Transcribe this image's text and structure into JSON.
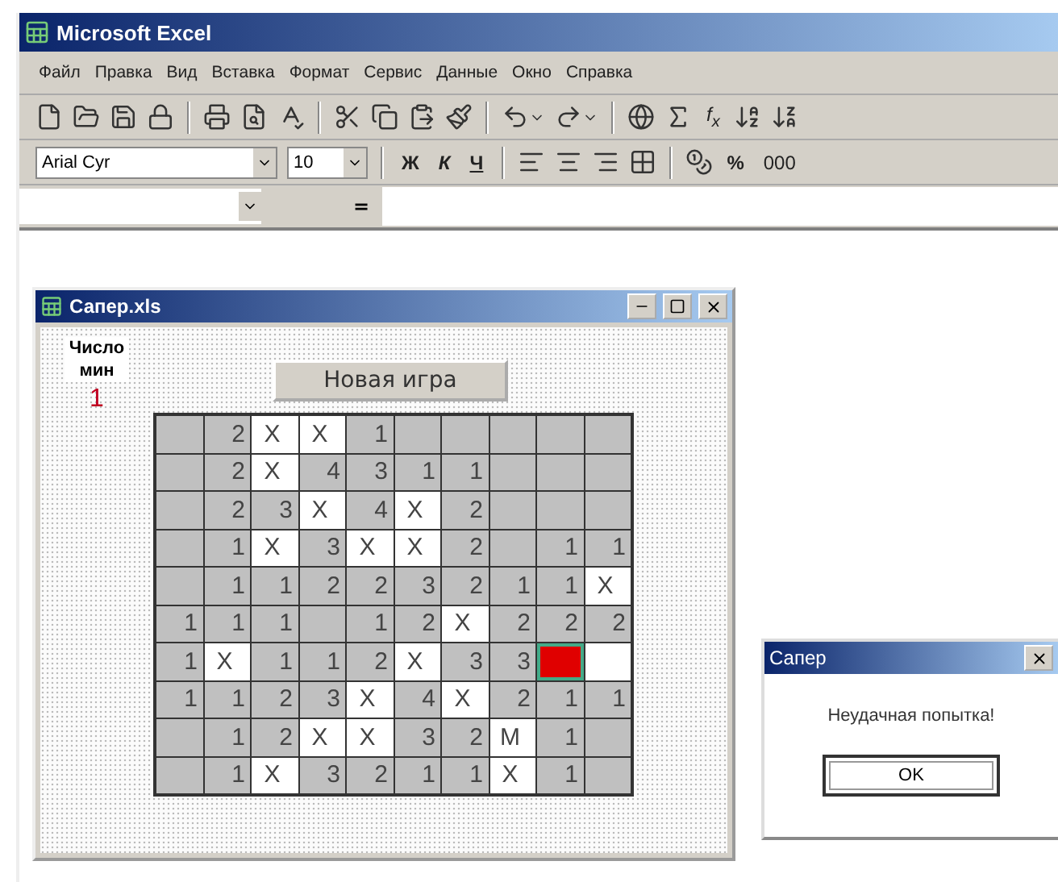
{
  "app": {
    "title": "Microsoft Excel"
  },
  "menu": [
    "Файл",
    "Правка",
    "Вид",
    "Вставка",
    "Формат",
    "Сервис",
    "Данные",
    "Окно",
    "Справка"
  ],
  "toolbar_standard": {
    "function_label": "f$_{x}$"
  },
  "toolbar_format": {
    "font": "Arial Cyr",
    "size": "10",
    "bold": "Ж",
    "italic": "К",
    "underline": "Ч",
    "percent": "%",
    "thousands": "000"
  },
  "formula_bar": {
    "equals": "="
  },
  "workbook": {
    "title": "Сапер.xls",
    "mines_label": "Число мин",
    "mines_count": "1",
    "new_game_button": "Новая игра",
    "grid": [
      [
        {
          "kind": "plain"
        },
        {
          "t": "2",
          "kind": "plain"
        },
        {
          "t": "X",
          "kind": "marked"
        },
        {
          "t": "X",
          "kind": "marked"
        },
        {
          "t": "1",
          "kind": "plain"
        },
        {
          "kind": "plain"
        },
        {
          "kind": "plain"
        },
        {
          "kind": "plain"
        },
        {
          "kind": "plain"
        },
        {
          "kind": "plain"
        }
      ],
      [
        {
          "kind": "plain"
        },
        {
          "t": "2",
          "kind": "plain"
        },
        {
          "t": "X",
          "kind": "marked"
        },
        {
          "t": "4",
          "kind": "plain"
        },
        {
          "t": "3",
          "kind": "plain"
        },
        {
          "t": "1",
          "kind": "plain"
        },
        {
          "t": "1",
          "kind": "plain"
        },
        {
          "kind": "plain"
        },
        {
          "kind": "plain"
        },
        {
          "kind": "plain"
        }
      ],
      [
        {
          "kind": "plain"
        },
        {
          "t": "2",
          "kind": "plain"
        },
        {
          "t": "3",
          "kind": "plain"
        },
        {
          "t": "X",
          "kind": "marked"
        },
        {
          "t": "4",
          "kind": "plain"
        },
        {
          "t": "X",
          "kind": "marked"
        },
        {
          "t": "2",
          "kind": "plain"
        },
        {
          "kind": "plain"
        },
        {
          "kind": "plain"
        },
        {
          "kind": "plain"
        }
      ],
      [
        {
          "kind": "plain"
        },
        {
          "t": "1",
          "kind": "plain"
        },
        {
          "t": "X",
          "kind": "marked"
        },
        {
          "t": "3",
          "kind": "plain"
        },
        {
          "t": "X",
          "kind": "marked"
        },
        {
          "t": "X",
          "kind": "marked"
        },
        {
          "t": "2",
          "kind": "plain"
        },
        {
          "kind": "plain"
        },
        {
          "t": "1",
          "kind": "plain"
        },
        {
          "t": "1",
          "kind": "plain"
        }
      ],
      [
        {
          "kind": "plain"
        },
        {
          "t": "1",
          "kind": "plain"
        },
        {
          "t": "1",
          "kind": "plain"
        },
        {
          "t": "2",
          "kind": "plain"
        },
        {
          "t": "2",
          "kind": "plain"
        },
        {
          "t": "3",
          "kind": "plain"
        },
        {
          "t": "2",
          "kind": "plain"
        },
        {
          "t": "1",
          "kind": "plain"
        },
        {
          "t": "1",
          "kind": "plain"
        },
        {
          "t": "X",
          "kind": "marked"
        }
      ],
      [
        {
          "t": "1",
          "kind": "plain"
        },
        {
          "t": "1",
          "kind": "plain"
        },
        {
          "t": "1",
          "kind": "plain"
        },
        {
          "kind": "plain"
        },
        {
          "t": "1",
          "kind": "plain"
        },
        {
          "t": "2",
          "kind": "plain"
        },
        {
          "t": "X",
          "kind": "marked"
        },
        {
          "t": "2",
          "kind": "plain"
        },
        {
          "t": "2",
          "kind": "plain"
        },
        {
          "t": "2",
          "kind": "plain"
        }
      ],
      [
        {
          "t": "1",
          "kind": "plain"
        },
        {
          "t": "X",
          "kind": "marked"
        },
        {
          "t": "1",
          "kind": "plain"
        },
        {
          "t": "1",
          "kind": "plain"
        },
        {
          "t": "2",
          "kind": "plain"
        },
        {
          "t": "X",
          "kind": "marked"
        },
        {
          "t": "3",
          "kind": "plain"
        },
        {
          "t": "3",
          "kind": "plain"
        },
        {
          "kind": "exploded"
        },
        {
          "kind": "marked"
        }
      ],
      [
        {
          "t": "1",
          "kind": "plain"
        },
        {
          "t": "1",
          "kind": "plain"
        },
        {
          "t": "2",
          "kind": "plain"
        },
        {
          "t": "3",
          "kind": "plain"
        },
        {
          "t": "X",
          "kind": "marked"
        },
        {
          "t": "4",
          "kind": "plain"
        },
        {
          "t": "X",
          "kind": "marked"
        },
        {
          "t": "2",
          "kind": "plain"
        },
        {
          "t": "1",
          "kind": "plain"
        },
        {
          "t": "1",
          "kind": "plain"
        }
      ],
      [
        {
          "kind": "plain"
        },
        {
          "t": "1",
          "kind": "plain"
        },
        {
          "t": "2",
          "kind": "plain"
        },
        {
          "t": "X",
          "kind": "marked"
        },
        {
          "t": "X",
          "kind": "marked"
        },
        {
          "t": "3",
          "kind": "plain"
        },
        {
          "t": "2",
          "kind": "plain"
        },
        {
          "t": "M",
          "kind": "marked"
        },
        {
          "t": "1",
          "kind": "plain"
        },
        {
          "kind": "plain"
        }
      ],
      [
        {
          "kind": "plain"
        },
        {
          "t": "1",
          "kind": "plain"
        },
        {
          "t": "X",
          "kind": "marked"
        },
        {
          "t": "3",
          "kind": "plain"
        },
        {
          "t": "2",
          "kind": "plain"
        },
        {
          "t": "1",
          "kind": "plain"
        },
        {
          "t": "1",
          "kind": "plain"
        },
        {
          "t": "X",
          "kind": "marked"
        },
        {
          "t": "1",
          "kind": "plain"
        },
        {
          "kind": "plain"
        }
      ]
    ]
  },
  "dialog": {
    "title": "Сапер",
    "message": "Неудачная попытка!",
    "ok": "OK"
  }
}
